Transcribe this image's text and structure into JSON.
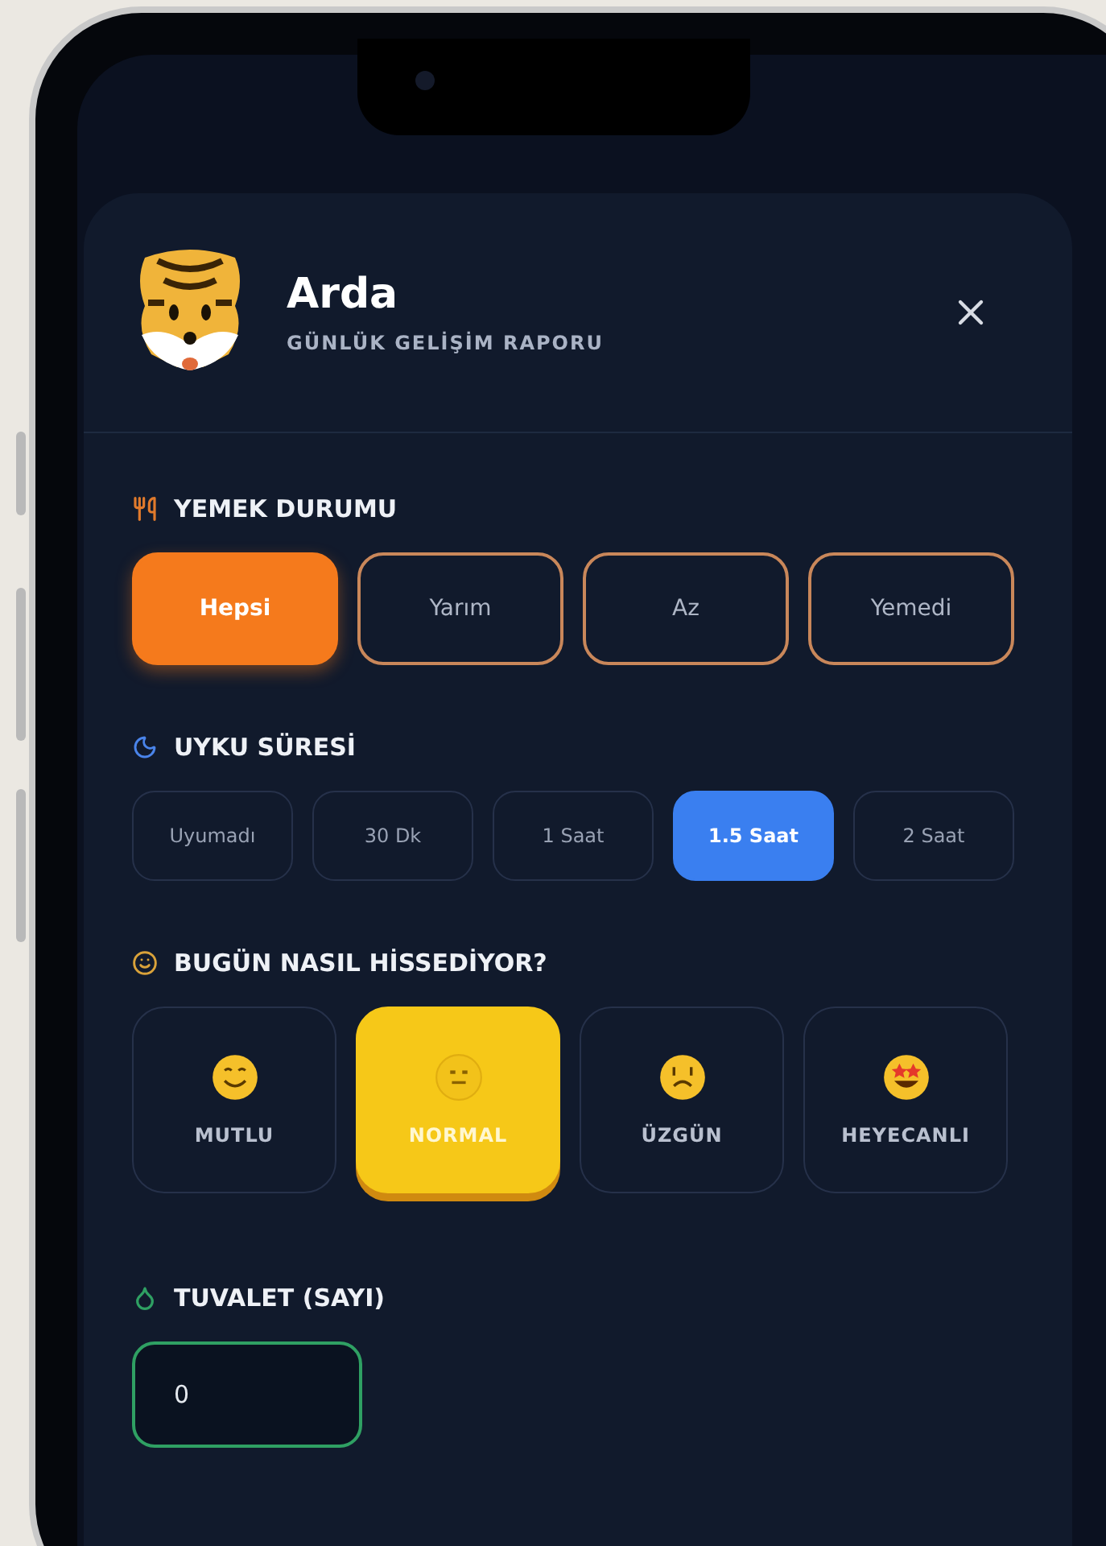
{
  "profile": {
    "name": "Arda",
    "subtitle": "GÜNLÜK GELİŞİM RAPORU"
  },
  "meal": {
    "title": "YEMEK DURUMU",
    "options": [
      {
        "label": "Hepsi",
        "selected": true
      },
      {
        "label": "Yarım",
        "selected": false
      },
      {
        "label": "Az",
        "selected": false
      },
      {
        "label": "Yemedi",
        "selected": false
      }
    ]
  },
  "sleep": {
    "title": "UYKU SÜRESİ",
    "options": [
      {
        "label": "Uyumadı",
        "selected": false
      },
      {
        "label": "30 Dk",
        "selected": false
      },
      {
        "label": "1 Saat",
        "selected": false
      },
      {
        "label": "1.5 Saat",
        "selected": true
      },
      {
        "label": "2 Saat",
        "selected": false
      }
    ]
  },
  "mood": {
    "title": "BUGÜN NASIL HİSSEDİYOR?",
    "options": [
      {
        "label": "MUTLU",
        "kind": "happy",
        "selected": false
      },
      {
        "label": "NORMAL",
        "kind": "neutral",
        "selected": true
      },
      {
        "label": "ÜZGÜN",
        "kind": "sad",
        "selected": false
      },
      {
        "label": "HEYECANLI",
        "kind": "excited",
        "selected": false
      }
    ]
  },
  "toilet": {
    "title": "TUVALET (SAYI)",
    "value": "0"
  }
}
